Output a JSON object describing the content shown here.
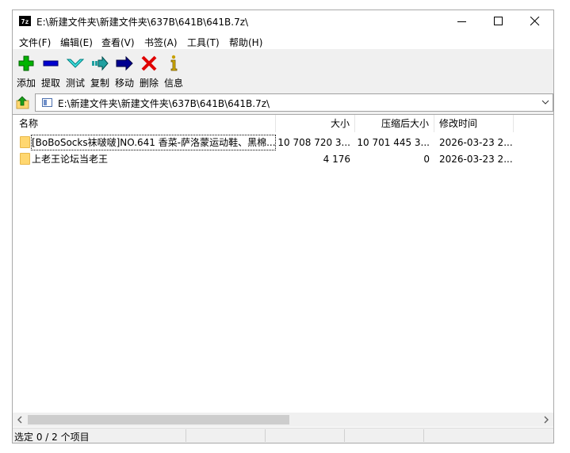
{
  "window": {
    "title": "E:\\新建文件夹\\新建文件夹\\637B\\641B\\641B.7z\\",
    "app_icon_text": "7z"
  },
  "menu": [
    "文件(F)",
    "编辑(E)",
    "查看(V)",
    "书签(A)",
    "工具(T)",
    "帮助(H)"
  ],
  "toolbar": [
    {
      "label": "添加",
      "icon": "plus-icon",
      "color": "#00a800"
    },
    {
      "label": "提取",
      "icon": "minus-icon",
      "color": "#0000c0"
    },
    {
      "label": "测试",
      "icon": "check-icon",
      "color": "#00b8b8"
    },
    {
      "label": "复制",
      "icon": "copy-arrow-icon",
      "color": "#008080"
    },
    {
      "label": "移动",
      "icon": "move-arrow-icon",
      "color": "#000080"
    },
    {
      "label": "删除",
      "icon": "delete-x-icon",
      "color": "#e00000"
    },
    {
      "label": "信息",
      "icon": "info-icon",
      "color": "#c0a000"
    }
  ],
  "address": {
    "path": "E:\\新建文件夹\\新建文件夹\\637B\\641B\\641B.7z\\"
  },
  "columns": [
    "名称",
    "大小",
    "压缩后大小",
    "修改时间"
  ],
  "rows": [
    {
      "name": "[BoBoSocks袜啵啵]NO.641 香菜-萨洛蒙运动鞋、黑棉...",
      "size": "10 708 720 3...",
      "packed": "10 701 445 3...",
      "modified": "2026-03-23 2..."
    },
    {
      "name": "上老王论坛当老王",
      "size": "4 176",
      "packed": "0",
      "modified": "2026-03-23 2..."
    }
  ],
  "status": {
    "text": "选定 0 / 2 个项目"
  }
}
